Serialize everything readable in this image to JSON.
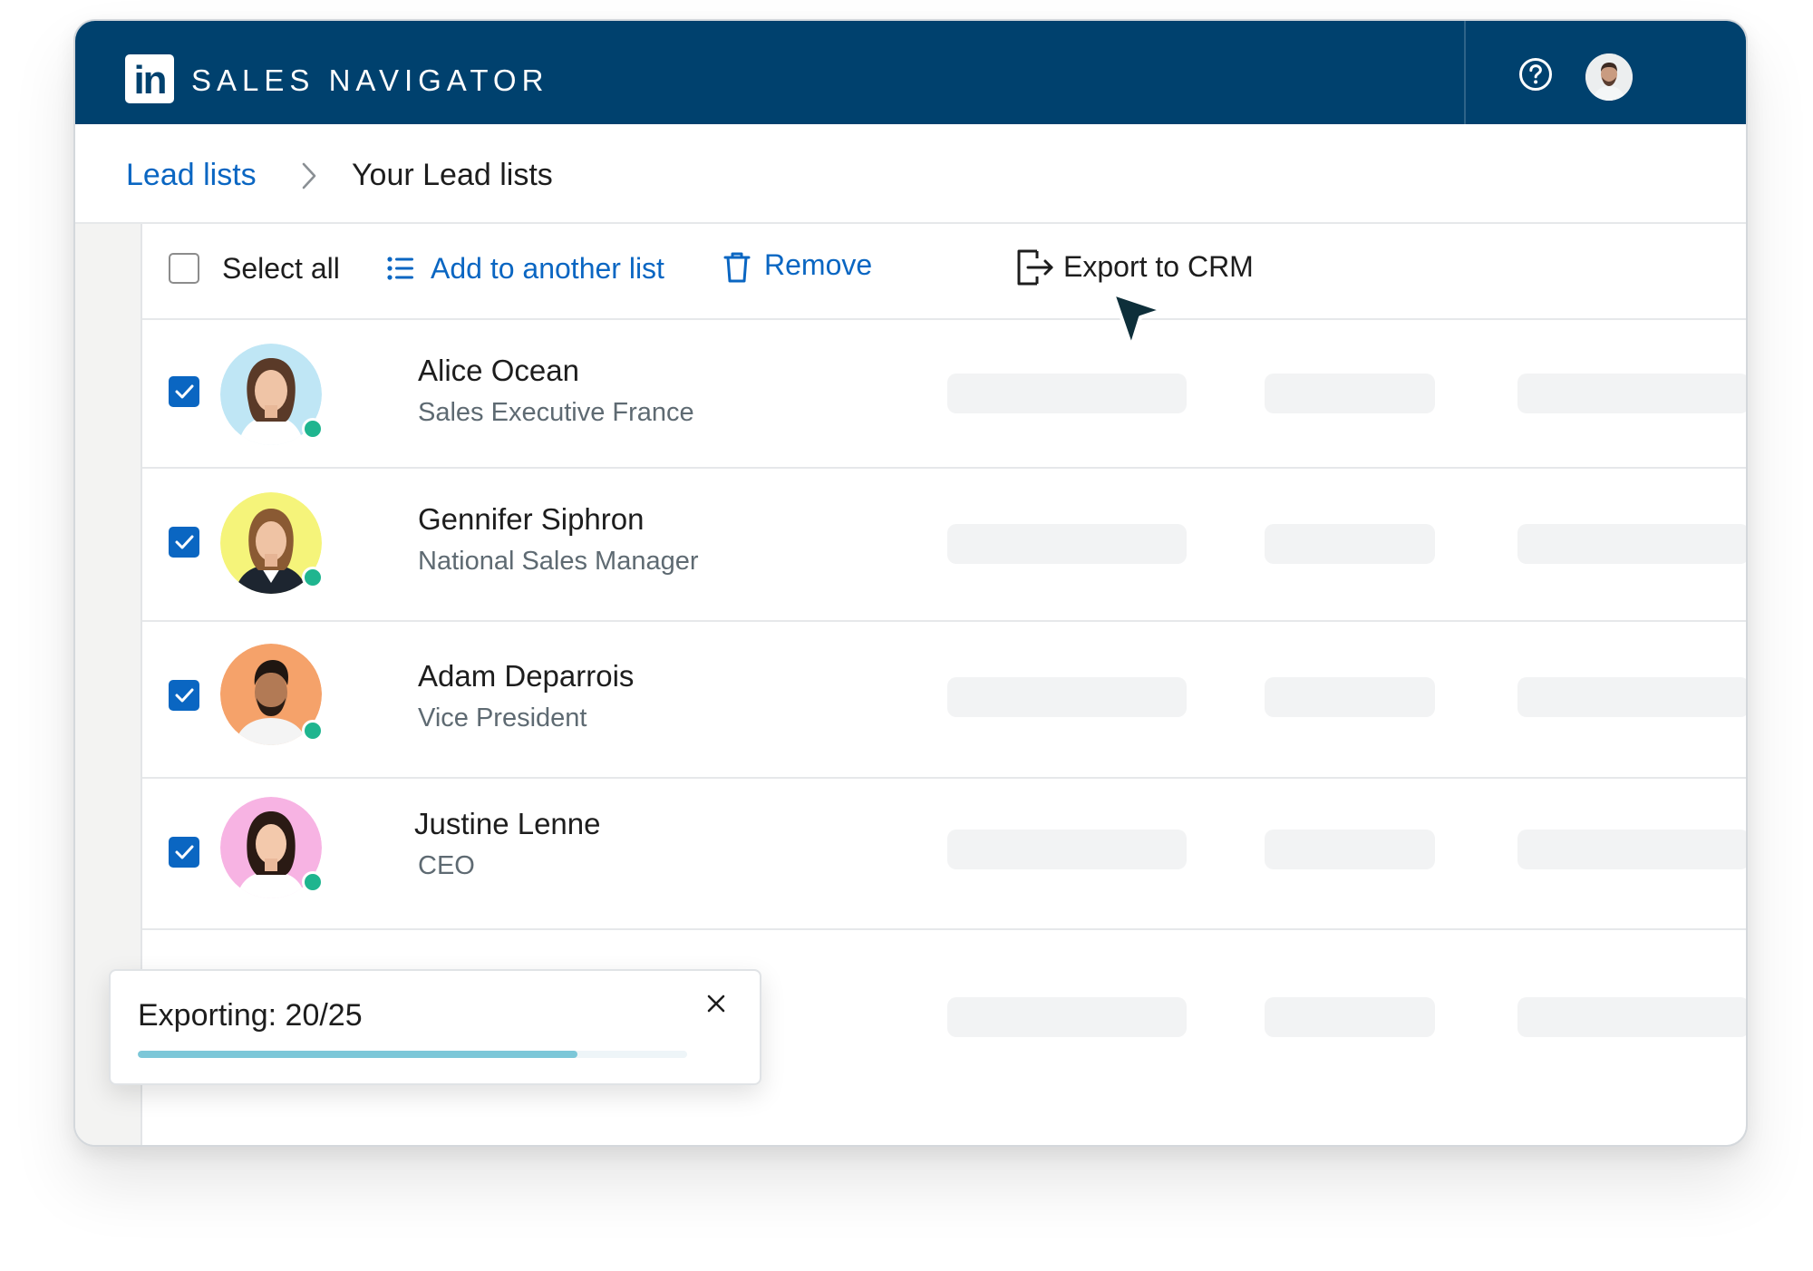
{
  "app": {
    "logo_text": "in",
    "brand_name": "SALES NAVIGATOR",
    "help_icon": "question-circle-icon",
    "profile_icon": "user-avatar"
  },
  "breadcrumb": {
    "link_label": "Lead lists",
    "separator_icon": "chevron-right-icon",
    "current_label": "Your Lead lists"
  },
  "toolbar": {
    "select_all_label": "Select all",
    "select_all_checked": false,
    "add_label": "Add to another list",
    "add_icon": "list-icon",
    "remove_label": "Remove",
    "remove_icon": "trash-icon",
    "export_label": "Export to CRM",
    "export_icon": "export-icon"
  },
  "leads": [
    {
      "name": "Alice Ocean",
      "title": "Sales Executive France",
      "checked": true,
      "online": true,
      "avatar_bg": "#bfe6f5"
    },
    {
      "name": "Gennifer Siphron",
      "title": "National Sales Manager",
      "checked": true,
      "online": true,
      "avatar_bg": "#f5f47a"
    },
    {
      "name": "Adam Deparrois",
      "title": "Vice President",
      "checked": true,
      "online": true,
      "avatar_bg": "#f5a26a"
    },
    {
      "name": "Justine Lenne",
      "title": "CEO",
      "checked": true,
      "online": true,
      "avatar_bg": "#f7b3e3"
    }
  ],
  "export_toast": {
    "text": "Exporting: 20/25",
    "progress": 0.8,
    "close_icon": "close-icon"
  },
  "colors": {
    "header": "#00416e",
    "link": "#0a66c2",
    "checkbox": "#0a66c2",
    "presence": "#1fb58f",
    "progress": "#7cc7d8"
  }
}
